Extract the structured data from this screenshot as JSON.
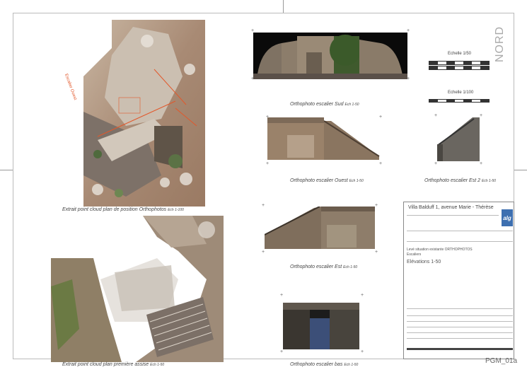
{
  "captions": {
    "plan_orthophotos": "Extrait point cloud plan de position Orthophotos",
    "plan_orthophotos_scale": "Ech 1-100",
    "plan_premiere": "Extrait point cloud plan première assise",
    "plan_premiere_scale": "Ech 1-50",
    "sud": "Orthophoto escalier Sud",
    "sud_scale": "Ech 1-50",
    "ouest": "Orthophoto escalier Ouest",
    "ouest_scale": "Ech 1-50",
    "est2": "Orthophoto escalier Est 2",
    "est2_scale": "Ech 1-50",
    "est": "Orthophoto escalier Est",
    "est_scale": "Ech 1-50",
    "bas": "Orthophoto escalier bas",
    "bas_scale": "Ech 1-50"
  },
  "scales": {
    "echelle_50": "Echelle 1/50",
    "echelle_100": "Echelle 1/100"
  },
  "north_label": "NORD",
  "title_block": {
    "address": "Villa Balduff 1, avenue Marie - Thérèse",
    "subtitle_line1": "Levé situation existante ORTHOPHOTOS",
    "subtitle_line2": "Escaliers",
    "elevations": "Elévations 1-50",
    "logo": "alg"
  },
  "sheet_id": "PGM_01a",
  "colors": {
    "annotation_red": "#e2582b",
    "logo_blue": "#3d6fb0"
  }
}
